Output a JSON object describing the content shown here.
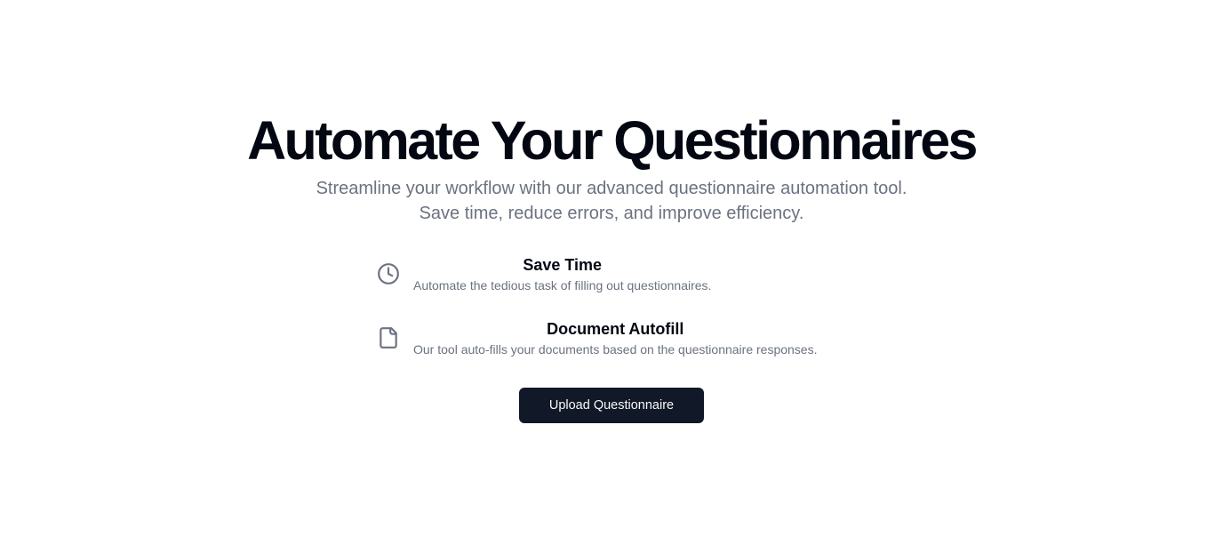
{
  "hero": {
    "title": "Automate Your Questionnaires",
    "subtitle": "Streamline your workflow with our advanced questionnaire automation tool. Save time, reduce errors, and improve efficiency."
  },
  "features": [
    {
      "icon": "clock-icon",
      "title": "Save Time",
      "description": "Automate the tedious task of filling out questionnaires."
    },
    {
      "icon": "file-icon",
      "title": "Document Autofill",
      "description": "Our tool auto-fills your documents based on the questionnaire responses."
    }
  ],
  "cta": {
    "upload_label": "Upload Questionnaire"
  },
  "colors": {
    "background": "#ffffff",
    "heading": "#030712",
    "muted_text": "#6b7280",
    "button_bg": "#111827",
    "button_text": "#f9fafb"
  }
}
